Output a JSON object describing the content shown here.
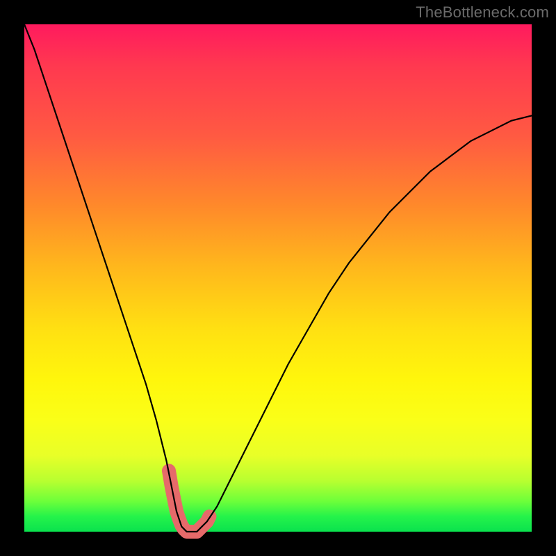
{
  "watermark": "TheBottleneck.com",
  "chart_data": {
    "type": "line",
    "title": "",
    "xlabel": "",
    "ylabel": "",
    "xlim": [
      0,
      100
    ],
    "ylim": [
      0,
      100
    ],
    "grid": false,
    "legend": false,
    "series": [
      {
        "name": "bottleneck-curve",
        "color": "#000000",
        "x": [
          0,
          2,
          4,
          6,
          8,
          10,
          12,
          14,
          16,
          18,
          20,
          22,
          24,
          26,
          28,
          29,
          30,
          31,
          32,
          33,
          34,
          35,
          36,
          38,
          40,
          44,
          48,
          52,
          56,
          60,
          64,
          68,
          72,
          76,
          80,
          84,
          88,
          92,
          96,
          100
        ],
        "y": [
          100,
          95,
          89,
          83,
          77,
          71,
          65,
          59,
          53,
          47,
          41,
          35,
          29,
          22,
          14,
          9,
          4,
          1,
          0,
          0,
          0,
          1,
          2,
          5,
          9,
          17,
          25,
          33,
          40,
          47,
          53,
          58,
          63,
          67,
          71,
          74,
          77,
          79,
          81,
          82
        ]
      },
      {
        "name": "highlight-band",
        "color": "#e66a6a",
        "x": [
          28.5,
          29.0,
          29.5,
          30.0,
          30.5,
          31.0,
          31.5,
          32.0,
          33.0,
          34.0,
          35.0,
          36.0,
          36.5
        ],
        "y": [
          12.0,
          9.0,
          6.5,
          4.0,
          2.5,
          1.2,
          0.5,
          0.0,
          0.0,
          0.0,
          1.0,
          2.0,
          3.0
        ]
      }
    ],
    "background_gradient": {
      "top": "#ff1a5e",
      "mid": "#ffe012",
      "bottom": "#0ae24e"
    }
  }
}
